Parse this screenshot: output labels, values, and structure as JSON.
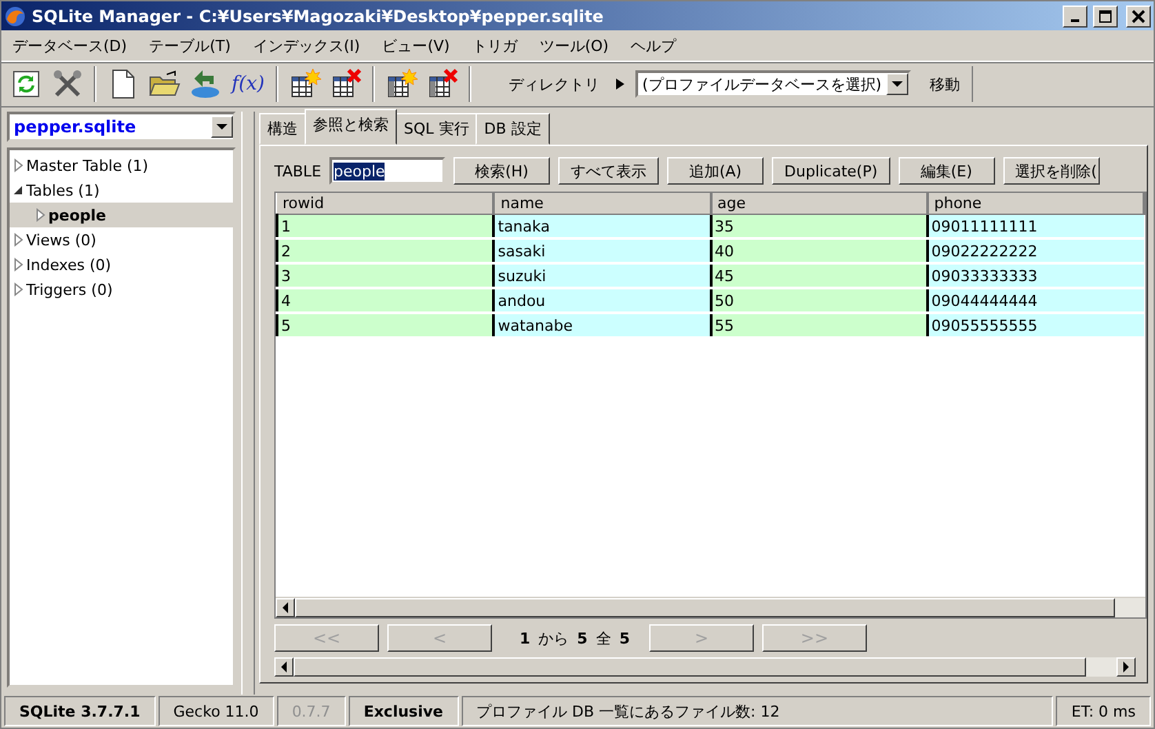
{
  "window": {
    "title": "SQLite Manager - C:¥Users¥Magozaki¥Desktop¥pepper.sqlite"
  },
  "menu": [
    "データベース(D)",
    "テーブル(T)",
    "インデックス(I)",
    "ビュー(V)",
    "トリガ",
    "ツール(O)",
    "ヘルプ"
  ],
  "toolbar": {
    "function_label": "f(x)",
    "directory_label": "ディレクトリ",
    "profile_select": "(プロファイルデータベースを選択)",
    "go_button": "移動"
  },
  "database_select": "pepper.sqlite",
  "tree": [
    {
      "label": "Master Table (1)",
      "expanded": false,
      "selected": false
    },
    {
      "label": "Tables (1)",
      "expanded": true,
      "selected": false,
      "children": [
        {
          "label": "people",
          "expanded": false,
          "selected": true
        }
      ]
    },
    {
      "label": "Views (0)",
      "expanded": false,
      "selected": false
    },
    {
      "label": "Indexes (0)",
      "expanded": false,
      "selected": false
    },
    {
      "label": "Triggers (0)",
      "expanded": false,
      "selected": false
    }
  ],
  "tabs": [
    {
      "label": "構造",
      "selected": false
    },
    {
      "label": "参照と検索",
      "selected": true
    },
    {
      "label": "SQL 実行",
      "selected": false
    },
    {
      "label": "DB 設定",
      "selected": false
    }
  ],
  "table_label": "TABLE",
  "table_field": "people",
  "actions": [
    "検索(H)",
    "すべて表示",
    "追加(A)",
    "Duplicate(P)",
    "編集(E)",
    "選択を削除("
  ],
  "table": {
    "columns": [
      "rowid",
      "name",
      "age",
      "phone"
    ],
    "rows": [
      [
        "1",
        "tanaka",
        "35",
        "09011111111"
      ],
      [
        "2",
        "sasaki",
        "40",
        "09022222222"
      ],
      [
        "3",
        "suzuki",
        "45",
        "09033333333"
      ],
      [
        "4",
        "andou",
        "50",
        "09044444444"
      ],
      [
        "5",
        "watanabe",
        "55",
        "09055555555"
      ]
    ]
  },
  "pager": {
    "first": {
      "label": "<<",
      "disabled": true
    },
    "prev": {
      "label": "<",
      "disabled": true
    },
    "from": "1",
    "from_word": "から",
    "to": "5",
    "total_word": "全",
    "total": "5",
    "next": {
      "label": ">",
      "disabled": true
    },
    "last": {
      "label": ">>",
      "disabled": true
    }
  },
  "status_bar": [
    {
      "text": "SQLite 3.7.7.1",
      "kind": "bold"
    },
    {
      "text": "Gecko 11.0",
      "kind": "plain"
    },
    {
      "text": "0.7.7",
      "kind": "grey"
    },
    {
      "text": "Exclusive",
      "kind": "bold"
    },
    {
      "text": "プロファイル DB 一覧にあるファイル数: 12",
      "kind": "wide"
    },
    {
      "text": "ET: 0 ms",
      "kind": "plain"
    }
  ]
}
